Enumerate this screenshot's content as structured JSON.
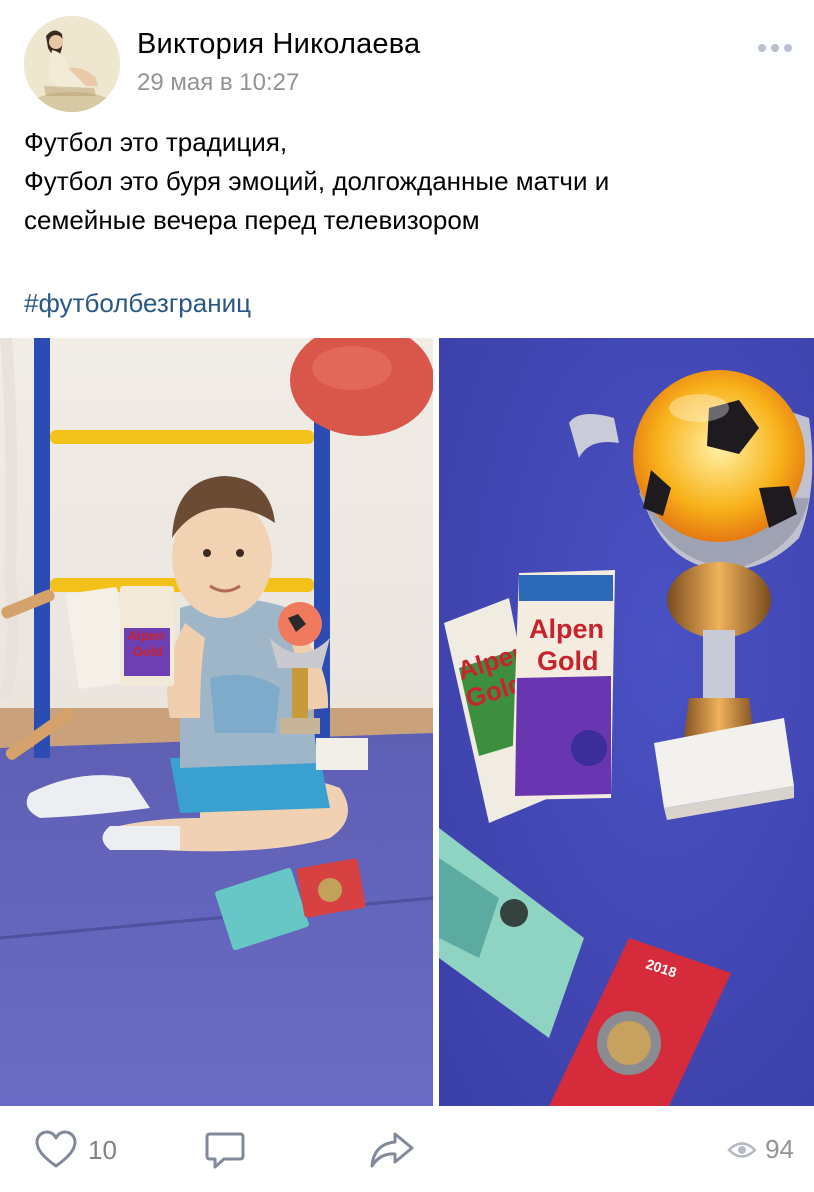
{
  "author": {
    "name": "Виктория Николаева",
    "date": "29 мая в 10:27"
  },
  "post": {
    "text_lines": [
      "Футбол это традиция,",
      "Футбол это буря эмоций, долгожданные матчи и",
      "семейные вечера перед телевизором"
    ],
    "hashtag": "#футболбезграниц"
  },
  "footer": {
    "likes": "10",
    "views": "94"
  },
  "icons": {
    "more": "more-dots-icon",
    "like": "heart-icon",
    "comment": "comment-icon",
    "share": "share-arrow-icon",
    "views": "eye-icon"
  },
  "colors": {
    "link": "#2a5885",
    "secondary_text": "#939393",
    "icon": "#828a99",
    "more_dots": "#b8c1cc"
  }
}
